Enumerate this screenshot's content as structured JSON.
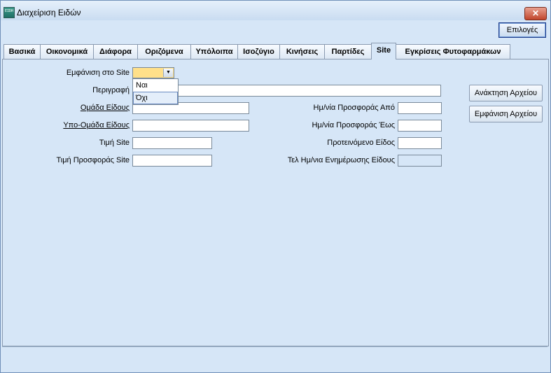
{
  "window": {
    "title": "Διαχείριση Ειδών",
    "close_label": "✕",
    "app_icon_text": "EIDH"
  },
  "toolbar": {
    "options_label": "Επιλογές"
  },
  "tabs": [
    {
      "label": "Βασικά"
    },
    {
      "label": "Οικονομικά"
    },
    {
      "label": "Διάφορα"
    },
    {
      "label": "Οριζόμενα"
    },
    {
      "label": "Υπόλοιπα"
    },
    {
      "label": "Ισοζύγιο"
    },
    {
      "label": "Κινήσεις"
    },
    {
      "label": "Παρτίδες"
    },
    {
      "label": "Site"
    },
    {
      "label": "Εγκρίσεις Φυτοφαρμάκων"
    }
  ],
  "active_tab": "Site",
  "form": {
    "show_on_site_label": "Εμφάνιση στο Site",
    "show_on_site_value": "",
    "show_on_site_options": [
      "Ναι",
      "Όχι"
    ],
    "description_label": "Περιγραφή",
    "group_label": "Ομάδα Είδους",
    "subgroup_label": "Υπο-Ομάδα Είδους",
    "site_price_label": "Τιμή Site",
    "site_offer_price_label": "Τιμή Προσφοράς Site",
    "offer_date_from_label": "Ημ/νία Προσφοράς Από",
    "offer_date_to_label": "Ημ/νία Προσφοράς Έως",
    "suggested_item_label": "Προτεινόμενο Είδος",
    "last_update_label": "Τελ Ημ/νια Ενημέρωσης Είδους"
  },
  "buttons": {
    "retrieve_file": "Ανάκτηση Αρχείου",
    "show_file": "Εμφάνιση Αρχείου"
  }
}
